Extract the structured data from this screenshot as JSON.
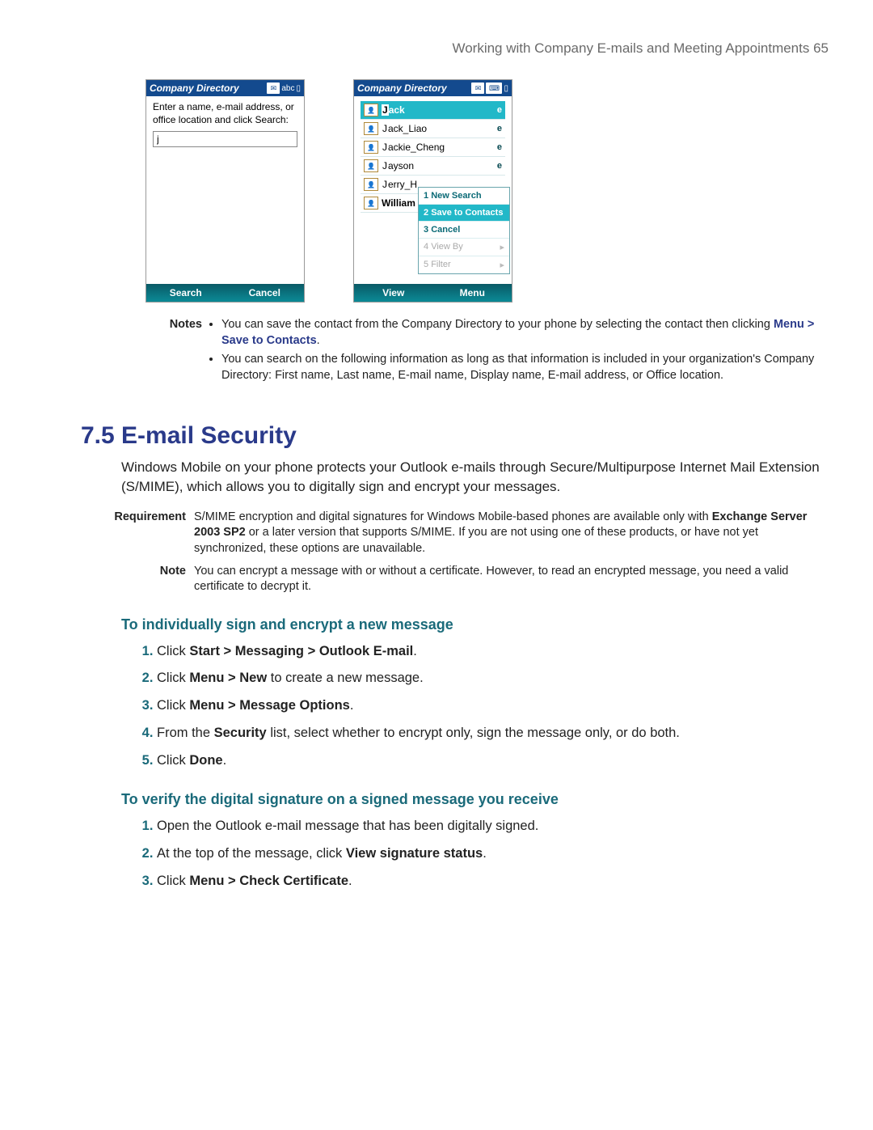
{
  "header": {
    "text": "Working with Company E-mails and Meeting Appointments  65"
  },
  "phone1": {
    "title": "Company Directory",
    "status_abc": "abc",
    "prompt": "Enter a name, e-mail address, or office location and click Search:",
    "input_value": "j",
    "left": "Search",
    "right": "Cancel"
  },
  "phone2": {
    "title": "Company Directory",
    "left": "View",
    "right": "Menu",
    "rows": [
      {
        "j": "J",
        "rest": "ack",
        "flag": "e",
        "sel": true
      },
      {
        "j": "J",
        "rest": "ack_Liao",
        "flag": "e"
      },
      {
        "j": "J",
        "rest": "ackie_Cheng",
        "flag": "e"
      },
      {
        "j": "J",
        "rest": "ayson",
        "flag": "e"
      },
      {
        "j": "J",
        "rest": "erry_H",
        "flag": ""
      },
      {
        "plain": "William",
        "flag": ""
      }
    ],
    "menu": [
      {
        "n": "1",
        "t": "New Search"
      },
      {
        "n": "2",
        "t": "Save to Contacts",
        "sel": true
      },
      {
        "n": "3",
        "t": "Cancel"
      },
      {
        "n": "4",
        "t": "View By",
        "dis": true
      },
      {
        "n": "5",
        "t": "Filter",
        "dis": true
      }
    ]
  },
  "notes1": {
    "label": "Notes",
    "b1a": "You can save the contact from the Company Directory to your phone by selecting the contact then clicking ",
    "b1b": "Menu > Save to Contacts",
    "b1c": ".",
    "b2": "You can search on the following information as long as that information is included in your organization's Company Directory: First name, Last name, E-mail name, Display name, E-mail address, or Office location."
  },
  "section": {
    "title": "7.5  E-mail Security"
  },
  "intro": "Windows Mobile on your phone protects your Outlook e-mails through Secure/Multipurpose Internet Mail Extension (S/MIME), which allows you to digitally sign and encrypt your messages.",
  "req": {
    "label": "Requirement",
    "t1": "S/MIME encryption and digital signatures for Windows Mobile-based phones are available only with ",
    "t2": "Exchange Server 2003 SP2",
    "t3": " or a later version that supports S/MIME. If you are not using one of these products, or have not yet synchronized, these options are unavailable."
  },
  "note2": {
    "label": "Note",
    "t": "You can encrypt a message with or without a certificate. However, to read an encrypted message, you need a valid certificate to decrypt it."
  },
  "sub1": "To individually sign and encrypt a new message",
  "steps1": {
    "s1a": "Click ",
    "s1b": "Start > Messaging > Outlook E-mail",
    "s1c": ".",
    "s2a": "Click ",
    "s2b": "Menu > New",
    "s2c": " to create a new message.",
    "s3a": "Click ",
    "s3b": "Menu > Message Options",
    "s3c": ".",
    "s4a": "From the ",
    "s4b": "Security",
    "s4c": " list, select whether to encrypt only, sign the message only, or do both.",
    "s5a": "Click ",
    "s5b": "Done",
    "s5c": "."
  },
  "sub2": "To verify the digital signature on a signed message you receive",
  "steps2": {
    "s1": "Open the Outlook e-mail message that has been digitally signed.",
    "s2a": "At the top of the message, click ",
    "s2b": "View signature status",
    "s2c": ".",
    "s3a": "Click ",
    "s3b": "Menu > Check Certificate",
    "s3c": "."
  }
}
